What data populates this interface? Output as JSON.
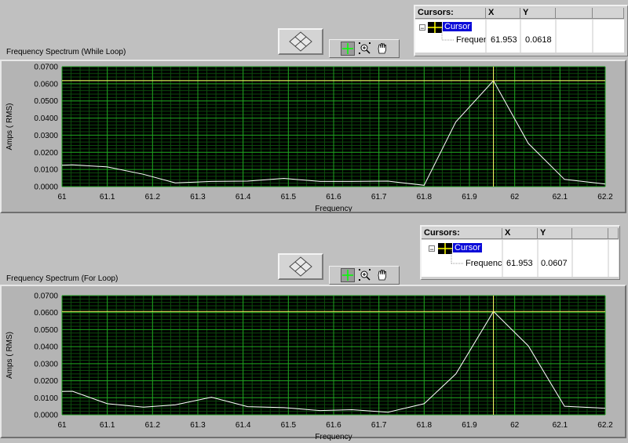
{
  "panels": [
    {
      "title": "Frequency Spectrum (While Loop)",
      "cursor_legend": {
        "header": "Cursors:",
        "col_x": "X",
        "col_y": "Y",
        "cursor_name": "Cursor",
        "row_label": "Frequer",
        "x_value": "61.953",
        "y_value": "0.0618"
      }
    },
    {
      "title": "Frequency Spectrum (For Loop)",
      "cursor_legend": {
        "header": "Cursors:",
        "col_x": "X",
        "col_y": "Y",
        "cursor_name": "Cursor",
        "row_label": "Frequency",
        "x_value": "61.953",
        "y_value": "0.0607"
      }
    }
  ],
  "chart_data": [
    {
      "type": "line",
      "title": "Frequency Spectrum (While Loop)",
      "xlabel": "Frequency",
      "ylabel": "Amps ( RMS)",
      "xlim": [
        61,
        62.2
      ],
      "ylim": [
        0,
        0.07
      ],
      "x_ticks": [
        "61",
        "61.1",
        "61.2",
        "61.3",
        "61.4",
        "61.5",
        "61.6",
        "61.7",
        "61.8",
        "61.9",
        "62",
        "62.1",
        "62.2"
      ],
      "y_ticks": [
        "0.0000",
        "0.0100",
        "0.0200",
        "0.0300",
        "0.0400",
        "0.0500",
        "0.0600",
        "0.0700"
      ],
      "grid": true,
      "background": "#000000",
      "grid_major_color": "#1f9e1f",
      "grid_minor_color": "#0d4a0d",
      "line_color": "#ffffff",
      "cursor_color": "#ffff66",
      "cursor": {
        "x": 61.953,
        "y": 0.0618
      },
      "series": [
        {
          "x": [
            61.0,
            61.023,
            61.1,
            61.18,
            61.25,
            61.33,
            61.41,
            61.49,
            61.57,
            61.64,
            61.72,
            61.8,
            61.87,
            61.953,
            62.03,
            62.11,
            62.2
          ],
          "y": [
            0.0125,
            0.0127,
            0.0115,
            0.0072,
            0.0022,
            0.003,
            0.0032,
            0.0048,
            0.003,
            0.003,
            0.0032,
            0.0008,
            0.0378,
            0.0618,
            0.0252,
            0.0042,
            0.0015
          ]
        }
      ]
    },
    {
      "type": "line",
      "title": "Frequency Spectrum (For Loop)",
      "xlabel": "Frequency",
      "ylabel": "Amps ( RMS)",
      "xlim": [
        61,
        62.2
      ],
      "ylim": [
        0,
        0.07
      ],
      "x_ticks": [
        "61",
        "61.1",
        "61.2",
        "61.3",
        "61.4",
        "61.5",
        "61.6",
        "61.7",
        "61.8",
        "61.9",
        "62",
        "62.1",
        "62.2"
      ],
      "y_ticks": [
        "0.0000",
        "0.0100",
        "0.0200",
        "0.0300",
        "0.0400",
        "0.0500",
        "0.0600",
        "0.0700"
      ],
      "grid": true,
      "background": "#000000",
      "grid_major_color": "#1f9e1f",
      "grid_minor_color": "#0d4a0d",
      "line_color": "#ffffff",
      "cursor_color": "#ffff66",
      "cursor": {
        "x": 61.953,
        "y": 0.0607
      },
      "series": [
        {
          "x": [
            61.0,
            61.023,
            61.1,
            61.18,
            61.25,
            61.33,
            61.41,
            61.49,
            61.57,
            61.64,
            61.72,
            61.8,
            61.87,
            61.953,
            62.03,
            62.11,
            62.2
          ],
          "y": [
            0.0137,
            0.0138,
            0.0065,
            0.0045,
            0.0058,
            0.0103,
            0.0048,
            0.0042,
            0.0025,
            0.003,
            0.0015,
            0.0065,
            0.024,
            0.0607,
            0.0405,
            0.005,
            0.0038
          ]
        }
      ]
    }
  ]
}
